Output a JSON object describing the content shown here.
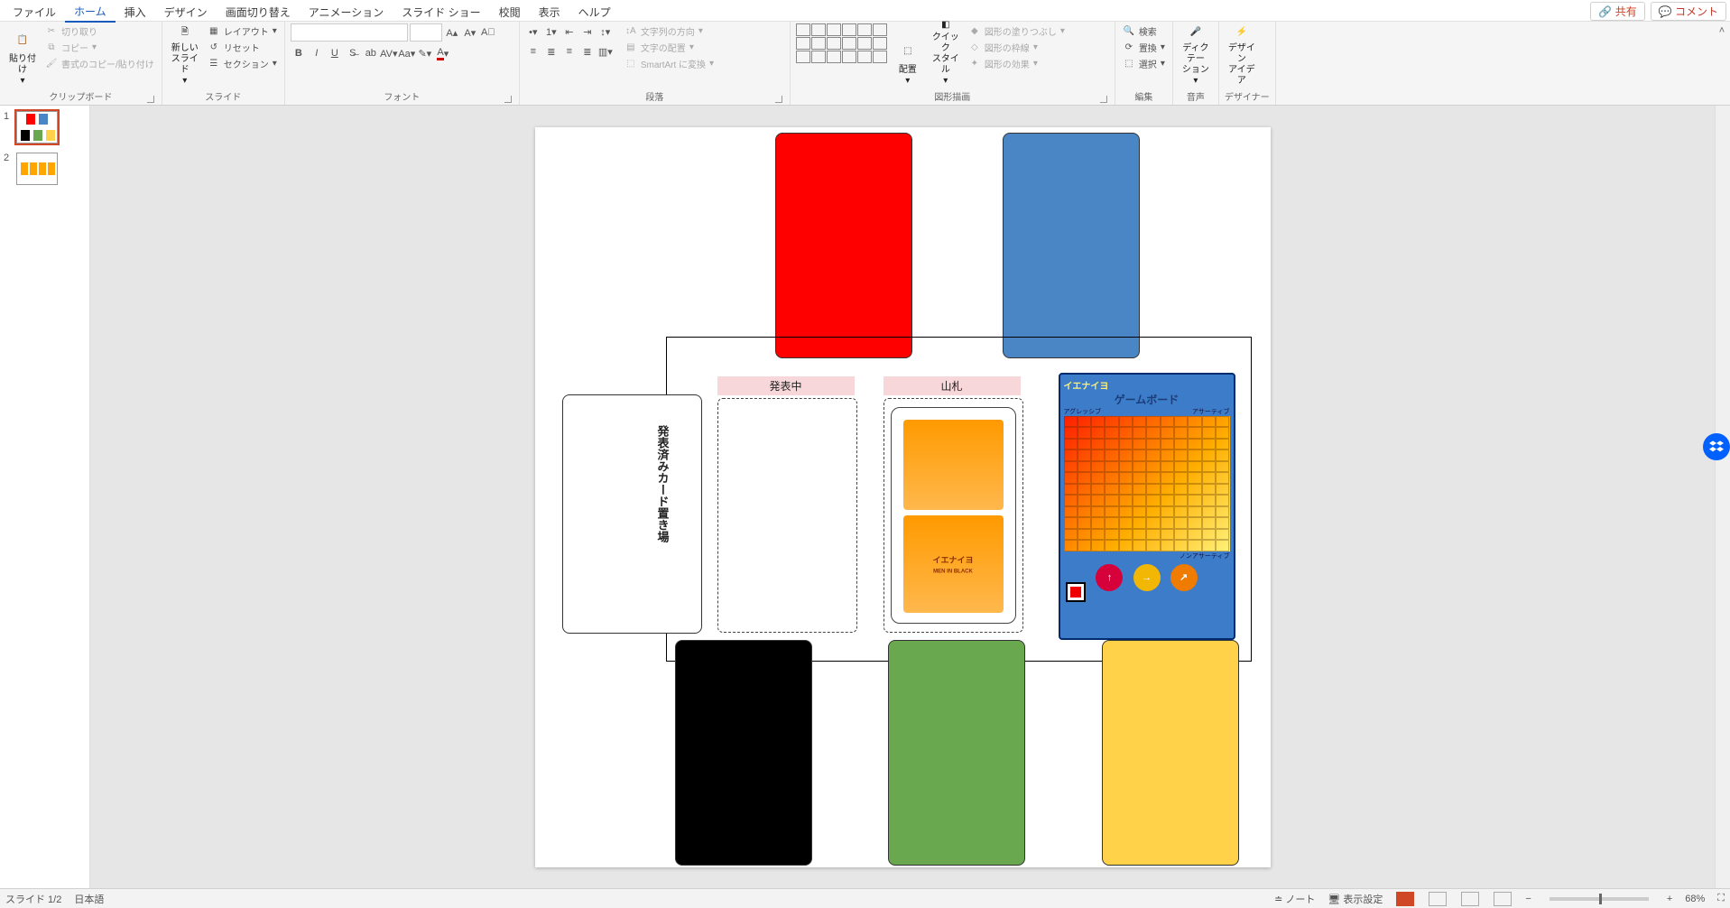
{
  "tabs": [
    "ファイル",
    "ホーム",
    "挿入",
    "デザイン",
    "画面切り替え",
    "アニメーション",
    "スライド ショー",
    "校閲",
    "表示",
    "ヘルプ"
  ],
  "active_tab": 1,
  "share_label": "共有",
  "comment_label": "コメント",
  "ribbon": {
    "clipboard": {
      "label": "クリップボード",
      "paste": "貼り付け",
      "cut": "切り取り",
      "copy": "コピー",
      "format_painter": "書式のコピー/貼り付け"
    },
    "slides": {
      "label": "スライド",
      "new": "新しい\nスライド",
      "layout": "レイアウト",
      "reset": "リセット",
      "section": "セクション"
    },
    "font": {
      "label": "フォント",
      "name": "",
      "size": ""
    },
    "paragraph": {
      "label": "段落",
      "text_dir": "文字列の方向",
      "text_align": "文字の配置",
      "smartart": "SmartArt に変換"
    },
    "drawing": {
      "label": "図形描画",
      "arrange": "配置",
      "quick": "クイック\nスタイル",
      "fill": "図形の塗りつぶし",
      "outline": "図形の枠線",
      "effects": "図形の効果"
    },
    "editing": {
      "label": "編集",
      "find": "検索",
      "replace": "置換",
      "select": "選択"
    },
    "voice": {
      "label": "音声",
      "dictate": "ディクテー\nション"
    },
    "designer": {
      "label": "デザイナー",
      "ideas": "デザイン\nアイデア"
    }
  },
  "thumbs": [
    1,
    2
  ],
  "selected_thumb": 1,
  "slide": {
    "zone_present": "発表中",
    "zone_deck": "山札",
    "discard_label": "発表済みカード置き場",
    "board_logo": "イエナイヨ",
    "board_title": "ゲームボード",
    "board_axis_left": "アグレッシブ",
    "board_axis_right": "アサーティブ",
    "board_axis_bottom": "ノンアサーティブ",
    "deck_logo": "イエナイヨ",
    "deck_sub": "MEN IN BLACK"
  },
  "status": {
    "slide": "スライド 1/2",
    "lang": "日本語",
    "notes": "ノート",
    "display": "表示設定",
    "zoom": "68%"
  }
}
